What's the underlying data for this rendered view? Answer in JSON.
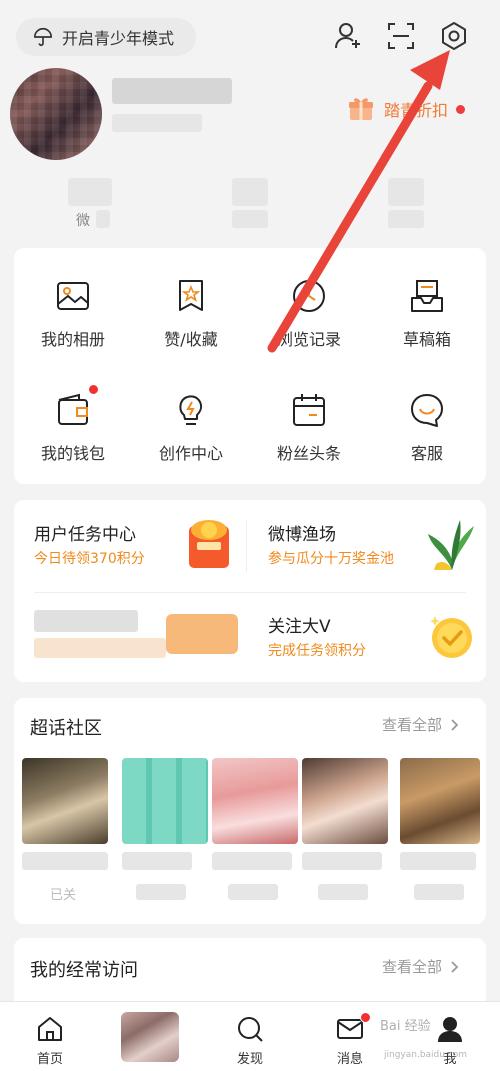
{
  "topbar": {
    "youth_mode_label": "开启青少年模式",
    "icons": [
      "add-friend-icon",
      "scan-icon",
      "settings-icon"
    ]
  },
  "profile": {
    "promo_label": "踏青折扣"
  },
  "stats": {
    "first_label_partial": "微"
  },
  "menu_grid": {
    "items": [
      {
        "label": "我的相册",
        "icon": "album-icon"
      },
      {
        "label": "赞/收藏",
        "icon": "favorite-icon"
      },
      {
        "label": "浏览记录",
        "icon": "history-icon"
      },
      {
        "label": "草稿箱",
        "icon": "drafts-icon"
      },
      {
        "label": "我的钱包",
        "icon": "wallet-icon"
      },
      {
        "label": "创作中心",
        "icon": "lightbulb-icon"
      },
      {
        "label": "粉丝头条",
        "icon": "calendar-icon"
      },
      {
        "label": "客服",
        "icon": "service-icon"
      }
    ]
  },
  "tasks": {
    "items": [
      {
        "title": "用户任务中心",
        "subtitle": "今日待领370积分"
      },
      {
        "title": "微博渔场",
        "subtitle": "参与瓜分十万奖金池"
      },
      {
        "title": "关注大V",
        "subtitle": "完成任务领积分"
      }
    ]
  },
  "supertopic": {
    "title": "超话社区",
    "see_all": "查看全部",
    "partial_text": "已关"
  },
  "frequent": {
    "title": "我的经常访问",
    "see_all": "查看全部"
  },
  "bottom_nav": {
    "items": [
      {
        "label": "首页",
        "icon": "home-icon"
      },
      {
        "label": "",
        "icon": "avatar-tab"
      },
      {
        "label": "发现",
        "icon": "search-icon"
      },
      {
        "label": "消息",
        "icon": "message-icon"
      },
      {
        "label": "我",
        "icon": "profile-icon"
      }
    ]
  },
  "watermark": {
    "text": "Bai 经验",
    "url": "jingyan.baidu.com"
  },
  "colors": {
    "accent_orange": "#f08a1c",
    "red_dot": "#f23030",
    "annotation_arrow": "#e8443a"
  }
}
